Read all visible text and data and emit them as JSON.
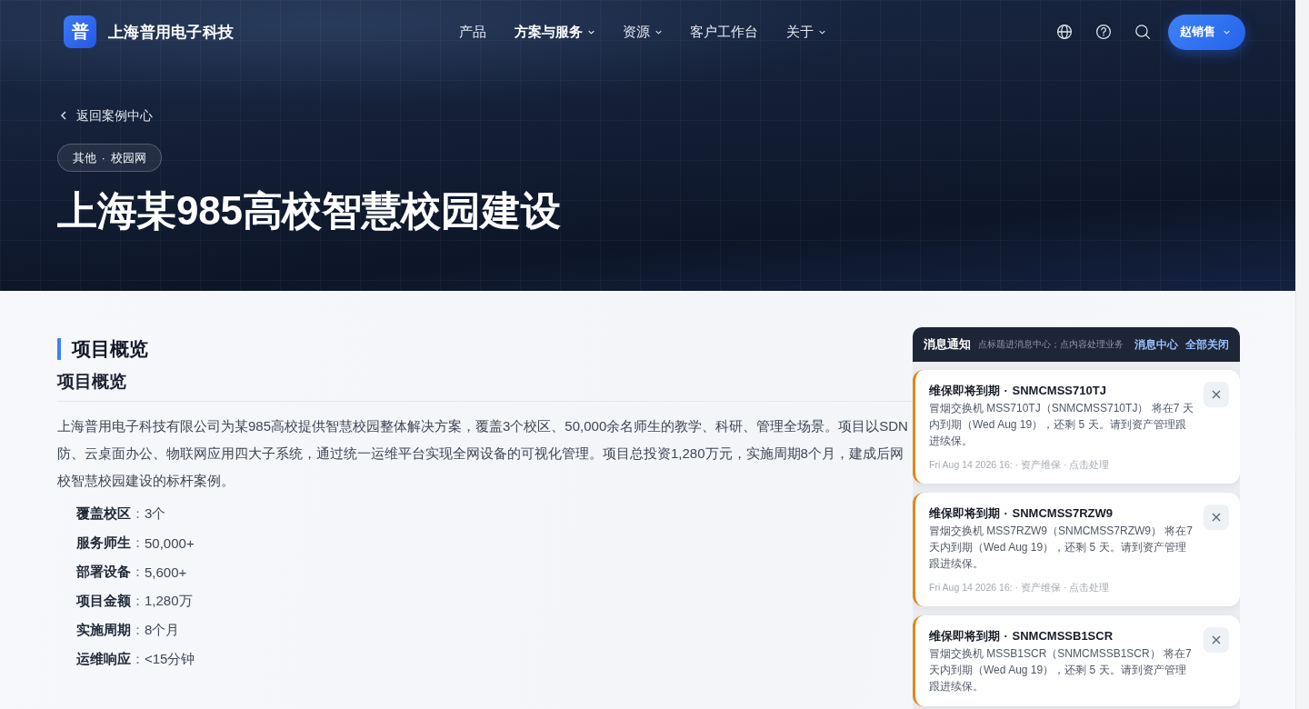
{
  "header": {
    "logo_mark": "普",
    "brand": "上海普用电子科技",
    "nav": [
      {
        "label": "产品",
        "selected": false,
        "dropdown": false
      },
      {
        "label": "方案与服务",
        "selected": true,
        "dropdown": true
      },
      {
        "label": "资源",
        "selected": false,
        "dropdown": true
      },
      {
        "label": "客户工作台",
        "selected": false,
        "dropdown": false
      },
      {
        "label": "关于",
        "selected": false,
        "dropdown": true
      }
    ],
    "user_menu": "赵销售"
  },
  "hero": {
    "back_link": "返回案例中心",
    "tag": "其他 · 校园网",
    "title": "上海某985高校智慧校园建设"
  },
  "overview": {
    "section_title": "项目概览",
    "subtitle": "项目概览",
    "paragraph_lines": [
      "上海普用电子科技有限公司为某985高校提供智慧校园整体解决方案，覆盖3个校区、50,000余名师生的教学、科研、管理全场景。项目以SDN",
      "防、云桌面办公、物联网应用四大子系统，通过统一运维平台实现全网设备的可视化管理。项目总投资1,280万元，实施周期8个月，建成后网",
      "校智慧校园建设的标杆案例。"
    ],
    "facts": [
      {
        "label": "**覆盖校区**：",
        "value": "3个"
      },
      {
        "label": "**服务师生**：",
        "value": "50,000+"
      },
      {
        "label": "**部署设备**：",
        "value": "5,600+"
      },
      {
        "label": "**项目金额**：",
        "value": "1,280万"
      },
      {
        "label": "**实施周期**：",
        "value": "8个月"
      },
      {
        "label": "**运维响应**：",
        "value": "<15分钟"
      }
    ]
  },
  "notifications": {
    "title": "消息通知",
    "hint": "点标题进消息中心；点内容处理业务",
    "links": [
      "消息中心",
      "全部关闭"
    ],
    "items": [
      {
        "title": "维保即将到期 · SNMCMSS710TJ",
        "body": "冒烟交换机 MSS710TJ（SNMCMSS710TJ） 将在7 天内到期（Wed Aug 19），还剩 5 天。请到资产管理跟进续保。",
        "meta": "Fri Aug 14 2026 16: · 资产维保 · 点击处理"
      },
      {
        "title": "维保即将到期 · SNMCMSS7RZW9",
        "body": "冒烟交换机 MSS7RZW9（SNMCMSS7RZW9） 将在7 天内到期（Wed Aug 19），还剩 5 天。请到资产管理跟进续保。",
        "meta": "Fri Aug 14 2026 16: · 资产维保 · 点击处理"
      },
      {
        "title": "维保即将到期 · SNMCMSSB1SCR",
        "body": "冒烟交换机 MSSB1SCR（SNMCMSSB1SCR） 将在7 天内到期（Wed Aug 19），还剩 5 天。请到资产管理跟进续保。"
      }
    ]
  }
}
